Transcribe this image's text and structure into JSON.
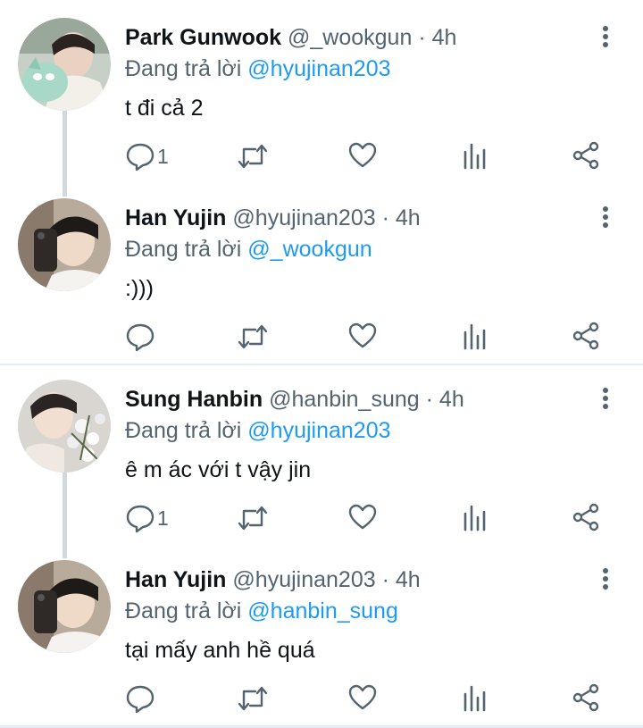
{
  "colors": {
    "accent": "#1d9bf0",
    "secondary_text": "#536471",
    "thread_line": "#cfd9de"
  },
  "tweets": [
    {
      "name": "Park Gunwook",
      "handle": "@_wookgun",
      "separator": "·",
      "time": "4h",
      "replying_prefix": "Đang trả lời",
      "replying_to": "@hyujinan203",
      "text": "t đi cả 2",
      "reply_count": "1"
    },
    {
      "name": "Han Yujin",
      "handle": "@hyujinan203",
      "separator": "·",
      "time": "4h",
      "replying_prefix": "Đang trả lời",
      "replying_to": "@_wookgun",
      "text": ":)))",
      "reply_count": ""
    },
    {
      "name": "Sung Hanbin",
      "handle": "@hanbin_sung",
      "separator": "·",
      "time": "4h",
      "replying_prefix": "Đang trả lời",
      "replying_to": "@hyujinan203",
      "text": "ê m ác với t vậy jin",
      "reply_count": "1"
    },
    {
      "name": "Han Yujin",
      "handle": "@hyujinan203",
      "separator": "·",
      "time": "4h",
      "replying_prefix": "Đang trả lời",
      "replying_to": "@hanbin_sung",
      "text": "tại mấy anh hề quá",
      "reply_count": ""
    }
  ],
  "icons": {
    "reply": "reply-icon",
    "retweet": "retweet-icon",
    "like": "heart-icon",
    "views": "analytics-icon",
    "share": "share-icon",
    "more": "more-vertical-icon"
  }
}
